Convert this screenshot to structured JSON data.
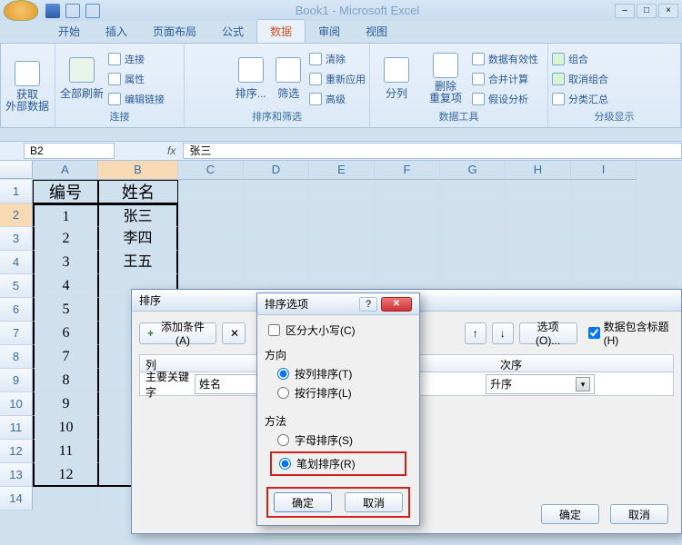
{
  "app_title": "Book1 - Microsoft Excel",
  "tabs": {
    "home": "开始",
    "insert": "插入",
    "page_layout": "页面布局",
    "formulas": "公式",
    "data": "数据",
    "review": "审阅",
    "view": "视图"
  },
  "ribbon": {
    "get_external": "获取\n外部数据",
    "refresh_all": "全部刷新",
    "connections": "连接",
    "properties": "属性",
    "edit_links": "编辑链接",
    "group_connections": "连接",
    "sort": "排序...",
    "filter": "筛选",
    "clear": "清除",
    "reapply": "重新应用",
    "advanced": "高级",
    "group_sort_filter": "排序和筛选",
    "text_to_columns": "分列",
    "remove_dup": "删除\n重复项",
    "data_validation": "数据有效性",
    "consolidate": "合并计算",
    "whatif": "假设分析",
    "group_data_tools": "数据工具",
    "group": "组合",
    "ungroup": "取消组合",
    "subtotal": "分类汇总",
    "group_outline": "分级显示"
  },
  "namebox": "B2",
  "formula": "张三",
  "columns": [
    "A",
    "B",
    "C",
    "D",
    "E",
    "F",
    "G",
    "H",
    "I"
  ],
  "rows": [
    1,
    2,
    3,
    4,
    5,
    6,
    7,
    8,
    9,
    10,
    11,
    12,
    13,
    14
  ],
  "data": {
    "A1": "编号",
    "B1": "姓名",
    "A2": "1",
    "B2": "张三",
    "A3": "2",
    "B3": "李四",
    "A4": "3",
    "B4": "王五",
    "A5": "4",
    "A6": "5",
    "A7": "6",
    "A8": "7",
    "A9": "8",
    "A10": "9",
    "A11": "10",
    "A12": "11",
    "A13": "12"
  },
  "sort_dialog": {
    "title": "排序",
    "add_level": "添加条件(A)",
    "options": "选项(O)...",
    "has_headers": "数据包含标题(H)",
    "column": "列",
    "order": "次序",
    "primary_key": "主要关键字",
    "primary_field": "姓名",
    "order_value": "升序",
    "ok": "确定",
    "cancel": "取消"
  },
  "sort_options_dialog": {
    "title": "排序选项",
    "case_sensitive": "区分大小写(C)",
    "direction": "方向",
    "top_to_bottom": "按列排序(T)",
    "left_to_right": "按行排序(L)",
    "method": "方法",
    "alphabetic": "字母排序(S)",
    "stroke": "笔划排序(R)",
    "ok": "确定",
    "cancel": "取消"
  }
}
